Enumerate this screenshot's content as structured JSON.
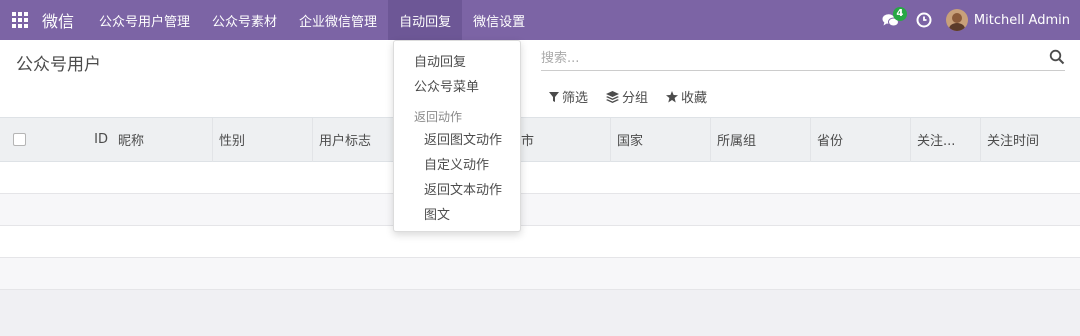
{
  "navbar": {
    "brand": "微信",
    "menu": [
      {
        "label": "公众号用户管理"
      },
      {
        "label": "公众号素材"
      },
      {
        "label": "企业微信管理"
      },
      {
        "label": "自动回复"
      },
      {
        "label": "微信设置"
      }
    ],
    "chat_badge": "4",
    "user_name": "Mitchell Admin",
    "bg_color": "#7c64a5"
  },
  "page": {
    "title": "公众号用户"
  },
  "search": {
    "placeholder": "搜索..."
  },
  "search_options": {
    "filter": "筛选",
    "group": "分组",
    "favorite": "收藏"
  },
  "table": {
    "columns": [
      "ID",
      "昵称",
      "性别",
      "用户标志",
      "城市",
      "国家",
      "所属组",
      "省份",
      "关注...",
      "关注时间"
    ]
  },
  "dropdown": {
    "items": [
      "自动回复",
      "公众号菜单"
    ],
    "section_header": "返回动作",
    "sub_items": [
      "返回图文动作",
      "自定义动作",
      "返回文本动作",
      "图文"
    ]
  }
}
